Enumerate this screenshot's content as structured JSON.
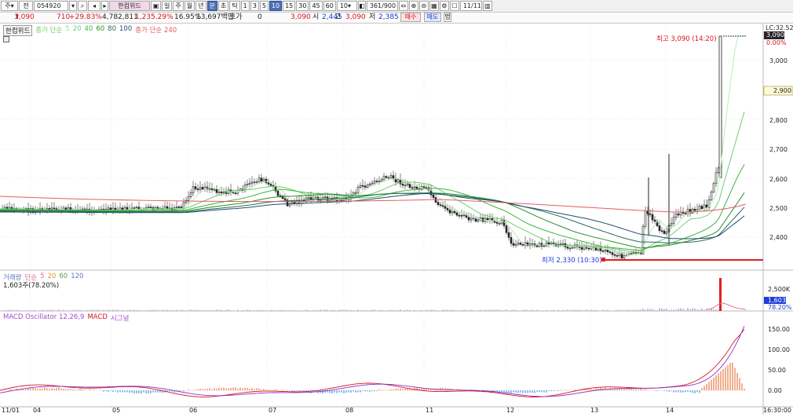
{
  "toolbar": {
    "market": "주",
    "type": "전",
    "code": "054920",
    "name": "한컴위드",
    "periods": [
      "일",
      "주",
      "월",
      "년",
      "분",
      "초",
      "틱"
    ],
    "selected_period": "분",
    "intervals": [
      "1",
      "3",
      "5",
      "10",
      "15",
      "30",
      "45",
      "60"
    ],
    "selected_interval": "10",
    "interval_value": "10",
    "count": "361",
    "total": "/900",
    "date": "11/11"
  },
  "quote": {
    "price": "3,090",
    "change": "710",
    "change_pct": "+29.83%",
    "volume": "4,782,811",
    "volume_pct": "1,235.29%",
    "turnover": "16.95%",
    "amount": "13,697백만",
    "bid_label": "호가",
    "bid": "0",
    "price2": "3,090",
    "open_label": "시",
    "open": "2,445",
    "high_label": "고",
    "high": "3,090",
    "low_label": "저",
    "low": "2,385",
    "buy_btn": "매수",
    "sell_btn": "매도",
    "extra_btn": "멍"
  },
  "price_pane": {
    "name": "한컴위드",
    "ma_label": "종가 단순",
    "ma_periods": [
      "5",
      "20",
      "40",
      "60",
      "80",
      "100"
    ],
    "ma_colors": [
      "#93e393",
      "#6fcf6f",
      "#3fb53f",
      "#2a8e2a",
      "#2b6b5b",
      "#1f4f6f"
    ],
    "long_ma_label": "종가 단순 240",
    "long_ma_color": "#e06060",
    "high_note": "최고 3,090 (14:20)",
    "low_note": "최저 2,330 (10:30)",
    "lc_label": "LC:32.52",
    "price_badge": "3,090",
    "pct_badge": "0.00%",
    "side_badge": "2,900",
    "y_ticks": [
      "3,000",
      "2,900",
      "2,800",
      "2,700",
      "2,600",
      "2,500",
      "2,400"
    ]
  },
  "volume_pane": {
    "name": "거래량",
    "ma_label": "단순",
    "ma_periods": [
      "5",
      "20",
      "60",
      "120"
    ],
    "ma_colors": [
      "#e06a9a",
      "#d89b2a",
      "#4aa44a",
      "#5a7abf"
    ],
    "value": "1,603주(78.20%)",
    "y_tick": "2,500K",
    "badge": "1,603",
    "badge_pct": "78.20%"
  },
  "macd_pane": {
    "name": "MACD Oscillator 12,26,9",
    "macd_label": "MACD",
    "signal_label": "시그널",
    "y_ticks": [
      "150.00",
      "100.00",
      "50.00",
      "0.00"
    ]
  },
  "x_axis": {
    "labels": [
      "11/01",
      "04",
      "05",
      "06",
      "07",
      "08",
      "11",
      "12",
      "13",
      "14"
    ],
    "end_time": "16:30:00"
  }
}
